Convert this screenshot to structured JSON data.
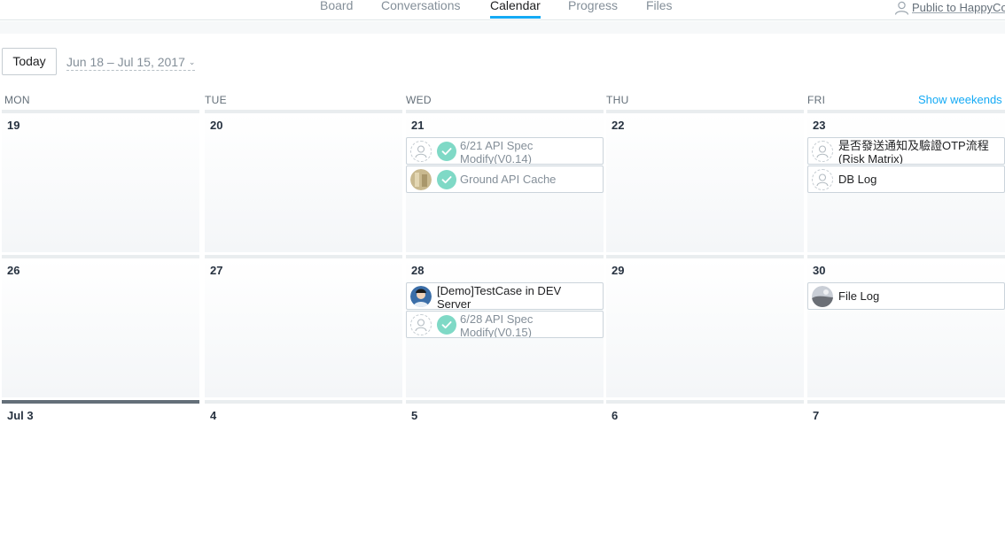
{
  "nav": {
    "tabs": [
      {
        "label": "Board"
      },
      {
        "label": "Conversations"
      },
      {
        "label": "Calendar"
      },
      {
        "label": "Progress"
      },
      {
        "label": "Files"
      }
    ],
    "active_tab": "Calendar",
    "privacy_label": "Public to HappyCo"
  },
  "toolbar": {
    "today_label": "Today",
    "range_label": "Jun 18 – Jul 15, 2017"
  },
  "calendar": {
    "weekdays": [
      "MON",
      "TUE",
      "WED",
      "THU",
      "FRI"
    ],
    "show_weekends_label": "Show weekends",
    "weeks": [
      {
        "days": [
          {
            "num": "19",
            "tasks": []
          },
          {
            "num": "20",
            "tasks": []
          },
          {
            "num": "21",
            "tasks": [
              {
                "name": "6/21 API Spec Modify(V0.14)",
                "completed": true,
                "assignee": "none"
              },
              {
                "name": "Ground API Cache",
                "completed": true,
                "assignee": "photo-beige"
              }
            ]
          },
          {
            "num": "22",
            "tasks": []
          },
          {
            "num": "23",
            "tasks": [
              {
                "name": "是否發送通知及驗證OTP流程(Risk Matrix)",
                "completed": false,
                "assignee": "none"
              },
              {
                "name": "DB Log",
                "completed": false,
                "assignee": "none"
              }
            ]
          }
        ]
      },
      {
        "days": [
          {
            "num": "26",
            "tasks": []
          },
          {
            "num": "27",
            "tasks": []
          },
          {
            "num": "28",
            "tasks": [
              {
                "name": "[Demo]TestCase in DEV Server",
                "completed": false,
                "assignee": "photo-person"
              },
              {
                "name": "6/28 API Spec Modify(V0.15)",
                "completed": true,
                "assignee": "none"
              }
            ]
          },
          {
            "num": "29",
            "tasks": []
          },
          {
            "num": "30",
            "tasks": [
              {
                "name": "File Log",
                "completed": false,
                "assignee": "photo-landscape"
              }
            ]
          }
        ]
      },
      {
        "days": [
          {
            "num": "Jul 3",
            "tasks": [],
            "is_today": true
          },
          {
            "num": "4",
            "tasks": []
          },
          {
            "num": "5",
            "tasks": []
          },
          {
            "num": "6",
            "tasks": []
          },
          {
            "num": "7",
            "tasks": []
          }
        ]
      }
    ]
  },
  "colors": {
    "accent": "#14aaf5",
    "check_fill": "#7fd9c6",
    "today_bar": "#646f79",
    "muted_text": "#848f99"
  },
  "icons": {
    "privacy": "person-outline-icon",
    "checkmark": "check-circle-icon",
    "unassigned": "person-placeholder-icon",
    "chevron": "chevron-down-icon"
  }
}
